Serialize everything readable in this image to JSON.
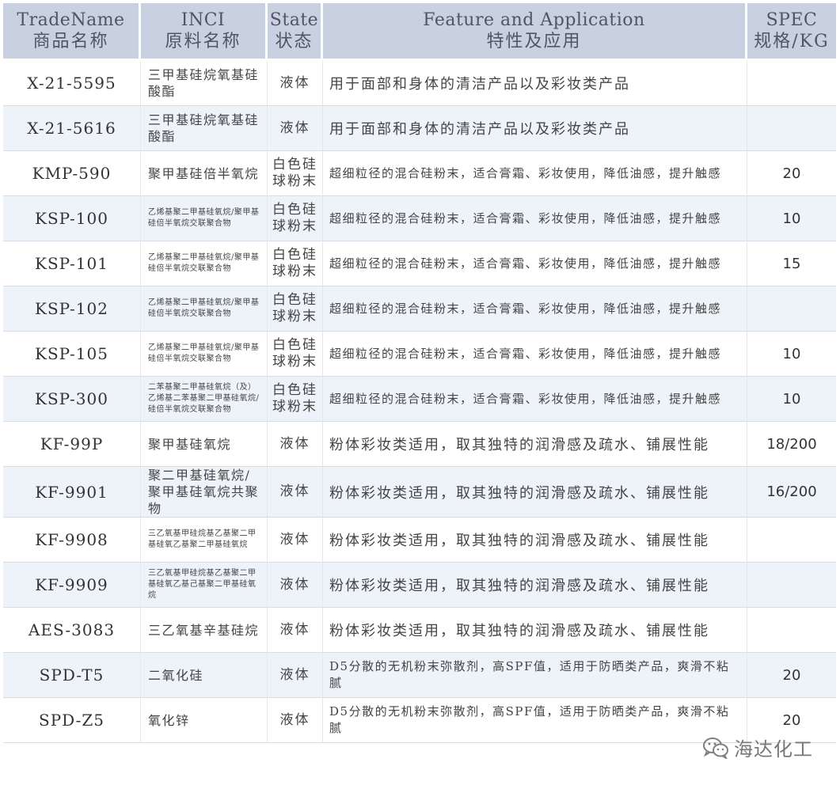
{
  "headers": [
    {
      "en": "TradeName",
      "cn": "商品名称"
    },
    {
      "en": "INCI",
      "cn": "原料名称"
    },
    {
      "en": "State",
      "cn": "状态"
    },
    {
      "en": "Feature and Application",
      "cn": "特性及应用"
    },
    {
      "en": "SPEC",
      "cn": "规格/KG"
    }
  ],
  "rows": [
    {
      "name": "X-21-5595",
      "inci": "三甲基硅烷氧基硅酸酯",
      "inci_small": false,
      "state": "液体",
      "feature": "用于面部和身体的清洁产品以及彩妆类产品",
      "feature_wrap": false,
      "spec": ""
    },
    {
      "name": "X-21-5616",
      "inci": "三甲基硅烷氧基硅酸酯",
      "inci_small": false,
      "state": "液体",
      "feature": "用于面部和身体的清洁产品以及彩妆类产品",
      "feature_wrap": false,
      "spec": ""
    },
    {
      "name": "KMP-590",
      "inci": "聚甲基硅倍半氧烷",
      "inci_small": false,
      "state": "白色硅球粉末",
      "feature": "超细粒径的混合硅粉末，适合膏霜、彩妆使用，降低油感，提升触感",
      "feature_wrap": true,
      "spec": "20"
    },
    {
      "name": "KSP-100",
      "inci": "乙烯基聚二甲基硅氧烷/聚甲基硅倍半氧烷交联聚合物",
      "inci_small": true,
      "state": "白色硅球粉末",
      "feature": "超细粒径的混合硅粉末，适合膏霜、彩妆使用，降低油感，提升触感",
      "feature_wrap": true,
      "spec": "10"
    },
    {
      "name": "KSP-101",
      "inci": "乙烯基聚二甲基硅氧烷/聚甲基硅倍半氧烷交联聚合物",
      "inci_small": true,
      "state": "白色硅球粉末",
      "feature": "超细粒径的混合硅粉末，适合膏霜、彩妆使用，降低油感，提升触感",
      "feature_wrap": true,
      "spec": "15"
    },
    {
      "name": "KSP-102",
      "inci": "乙烯基聚二甲基硅氧烷/聚甲基硅倍半氧烷交联聚合物",
      "inci_small": true,
      "state": "白色硅球粉末",
      "feature": "超细粒径的混合硅粉末，适合膏霜、彩妆使用，降低油感，提升触感",
      "feature_wrap": true,
      "spec": ""
    },
    {
      "name": "KSP-105",
      "inci": "乙烯基聚二甲基硅氧烷/聚甲基硅倍半氧烷交联聚合物",
      "inci_small": true,
      "state": "白色硅球粉末",
      "feature": "超细粒径的混合硅粉末，适合膏霜、彩妆使用，降低油感，提升触感",
      "feature_wrap": true,
      "spec": "10"
    },
    {
      "name": "KSP-300",
      "inci": "二苯基聚二甲基硅氧烷（及）乙烯基二苯基聚二甲基硅氧烷/硅倍半氧烷交联聚合物",
      "inci_small": true,
      "state": "白色硅球粉末",
      "feature": "超细粒径的混合硅粉末，适合膏霜、彩妆使用，降低油感，提升触感",
      "feature_wrap": true,
      "spec": "10"
    },
    {
      "name": "KF-99P",
      "inci": "聚甲基硅氧烷",
      "inci_small": false,
      "state": "液体",
      "feature": "粉体彩妆类适用，取其独特的润滑感及疏水、铺展性能",
      "feature_wrap": false,
      "spec": "18/200"
    },
    {
      "name": "KF-9901",
      "inci": "聚二甲基硅氧烷/聚甲基硅氧烷共聚物",
      "inci_small": false,
      "state": "液体",
      "feature": "粉体彩妆类适用，取其独特的润滑感及疏水、铺展性能",
      "feature_wrap": false,
      "spec": "16/200"
    },
    {
      "name": "KF-9908",
      "inci": "三乙氧基甲硅烷基乙基聚二甲基硅氧乙基聚二甲基硅氧烷",
      "inci_small": true,
      "state": "液体",
      "feature": "粉体彩妆类适用，取其独特的润滑感及疏水、铺展性能",
      "feature_wrap": false,
      "spec": ""
    },
    {
      "name": "KF-9909",
      "inci": "三乙氧基甲硅烷基乙基聚二甲基硅氧乙基己基聚二甲基硅氧烷",
      "inci_small": true,
      "state": "液体",
      "feature": "粉体彩妆类适用，取其独特的润滑感及疏水、铺展性能",
      "feature_wrap": false,
      "spec": ""
    },
    {
      "name": "AES-3083",
      "inci": "三乙氧基辛基硅烷",
      "inci_small": false,
      "state": "液体",
      "feature": "粉体彩妆类适用，取其独特的润滑感及疏水、铺展性能",
      "feature_wrap": false,
      "spec": ""
    },
    {
      "name": "SPD-T5",
      "inci": "二氧化硅",
      "inci_small": false,
      "state": "液体",
      "feature": "D5分散的无机粉末弥散剂，高SPF值，适用于防晒类产品，爽滑不粘腻",
      "feature_wrap": true,
      "spec": "20"
    },
    {
      "name": "SPD-Z5",
      "inci": "氧化锌",
      "inci_small": false,
      "state": "液体",
      "feature": "D5分散的无机粉末弥散剂，高SPF值，适用于防晒类产品，爽滑不粘腻",
      "feature_wrap": true,
      "spec": "20"
    }
  ],
  "watermark": {
    "icon": "wechat-icon",
    "text": "海达化工",
    "color": "#777777"
  },
  "colors": {
    "header_bg": "#c9d1e0",
    "header_text": "#4f5566",
    "row_alt_bg": "#eef3fa",
    "row_bg": "#ffffff"
  }
}
